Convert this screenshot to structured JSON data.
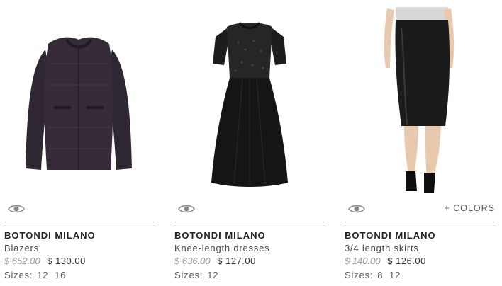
{
  "products": [
    {
      "brand": "BOTONDI MILANO",
      "category": "Blazers",
      "old_price": "$ 652.00",
      "new_price": "$ 130.00",
      "sizes_label": "Sizes:",
      "sizes": "12  16",
      "colors_link": ""
    },
    {
      "brand": "BOTONDI MILANO",
      "category": "Knee-length dresses",
      "old_price": "$ 636.00",
      "new_price": "$ 127.00",
      "sizes_label": "Sizes:",
      "sizes": "12",
      "colors_link": ""
    },
    {
      "brand": "BOTONDI MILANO",
      "category": "3/4 length skirts",
      "old_price": "$ 140.00",
      "new_price": "$ 126.00",
      "sizes_label": "Sizes:",
      "sizes": "8  12",
      "colors_link": "+ COLORS"
    }
  ],
  "icons": {
    "quick_view": "eye-icon"
  },
  "colors": {
    "rule": "#9a9a9a",
    "old_price": "#9a9a9a",
    "text": "#333333"
  }
}
